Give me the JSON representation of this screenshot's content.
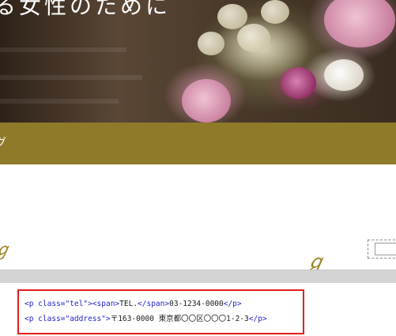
{
  "hero": {
    "title": "る女性のために"
  },
  "nav": {
    "label": "グ"
  },
  "code": {
    "tel_line": {
      "open_p": "<p class=",
      "class_name": "\"tel\"",
      "close_bracket": ">",
      "open_span": "<span>",
      "text": "TEL.",
      "close_span": "</span>",
      "value": "03-1234-0000",
      "close_p": "</p>"
    },
    "address_line": {
      "open_p": "<p class=",
      "class_name": "\"address\"",
      "close_bracket": ">",
      "value": "〒163-0000 東京都〇〇区〇〇〇1-2-3",
      "close_p": "</p>"
    }
  },
  "colors": {
    "nav_band": "#8f7a2a",
    "ornament": "#9c8424",
    "highlight_border": "#e21d1d",
    "code_tag": "#1f1fd0"
  },
  "icons": {
    "ornament_left": "flourish-icon",
    "ornament_right": "flourish-icon"
  }
}
